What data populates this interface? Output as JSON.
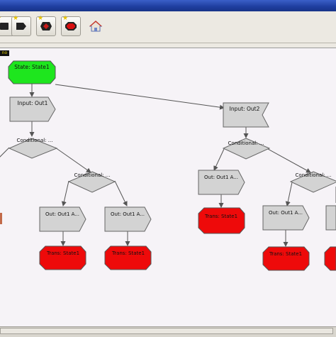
{
  "toolbar": {
    "buttons": [
      {
        "icon": "state-node-icon",
        "fill": "#222222"
      },
      {
        "icon": "output-node-icon",
        "fill": "#222222"
      },
      {
        "icon": "conditional-node-icon",
        "fill": "#c91a1a"
      },
      {
        "icon": "transition-node-icon",
        "fill": "#d80f0f"
      },
      {
        "icon": "home-icon"
      }
    ]
  },
  "frame_tag": "no",
  "diagram": {
    "state": {
      "label": "State: State1",
      "color": "#1ee61e"
    },
    "inputs": [
      {
        "label": "Input: Out1"
      },
      {
        "label": "Input: Out2"
      }
    ],
    "conditionals": [
      {
        "label": "Conditional: ..."
      },
      {
        "label": "Conditional: ..."
      },
      {
        "label": "Conditional: ..."
      },
      {
        "label": "Conditional: ..."
      }
    ],
    "outputs": [
      {
        "label": "Out: Out1 A..."
      },
      {
        "label": "Out: Out1 A..."
      },
      {
        "label": "Out: Out1 A..."
      },
      {
        "label": "Out: Out1 A..."
      }
    ],
    "transitions": [
      {
        "label": "Trans: State1",
        "color": "#ee0a0a"
      },
      {
        "label": "Trans: State1",
        "color": "#ee0a0a"
      },
      {
        "label": "Trans: State1",
        "color": "#ee0a0a"
      },
      {
        "label": "Trans: State1",
        "color": "#ee0a0a"
      }
    ],
    "colors": {
      "node_fill": "#d3d3d3",
      "node_stroke": "#666666",
      "edge": "#555555"
    }
  }
}
